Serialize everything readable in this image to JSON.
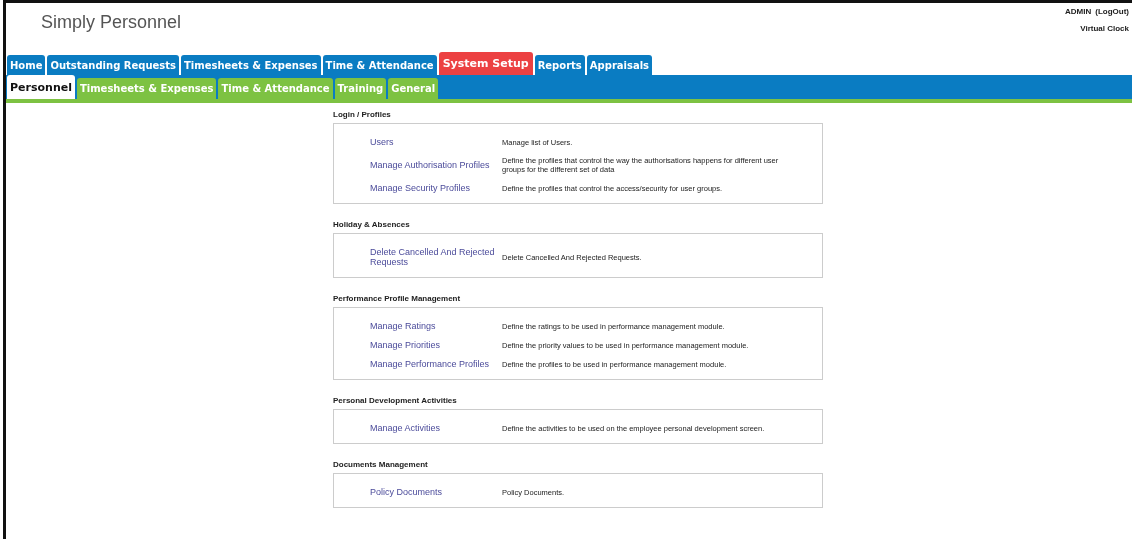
{
  "header": {
    "app_title": "Simply Personnel",
    "user": "ADMIN",
    "logout": "(LogOut)",
    "clock_link": "Virtual Clock"
  },
  "main_tabs": [
    {
      "label": "Home",
      "selected": false
    },
    {
      "label": "Outstanding Requests",
      "selected": false
    },
    {
      "label": "Timesheets & Expenses",
      "selected": false
    },
    {
      "label": "Time & Attendance",
      "selected": false
    },
    {
      "label": "System Setup",
      "selected": true
    },
    {
      "label": "Reports",
      "selected": false
    },
    {
      "label": "Appraisals",
      "selected": false
    }
  ],
  "sub_tabs": [
    {
      "label": "Personnel",
      "selected": true
    },
    {
      "label": "Timesheets & Expenses",
      "selected": false
    },
    {
      "label": "Time & Attendance",
      "selected": false
    },
    {
      "label": "Training",
      "selected": false
    },
    {
      "label": "General",
      "selected": false
    }
  ],
  "sections": [
    {
      "title": "Login / Profiles",
      "items": [
        {
          "link": "Users",
          "description": "Manage list of Users."
        },
        {
          "link": "Manage Authorisation Profiles",
          "description": "Define the profiles that control the way the authorisations happens for different user groups for the different set of data"
        },
        {
          "link": "Manage Security Profiles",
          "description": "Define the profiles that control the access/security for user groups."
        }
      ]
    },
    {
      "title": "Holiday & Absences",
      "items": [
        {
          "link": "Delete Cancelled And Rejected Requests",
          "description": "Delete Cancelled And Rejected Requests."
        }
      ]
    },
    {
      "title": "Performance Profile Management",
      "items": [
        {
          "link": "Manage Ratings",
          "description": "Define the ratings to be used in performance management module."
        },
        {
          "link": "Manage Priorities",
          "description": "Define the priority values to be used in performance management module."
        },
        {
          "link": "Manage Performance Profiles",
          "description": "Define the profiles to be used in performance management module."
        }
      ]
    },
    {
      "title": "Personal Development Activities",
      "items": [
        {
          "link": "Manage Activities",
          "description": "Define the activities to be used on the employee personal development screen."
        }
      ]
    },
    {
      "title": "Documents Management",
      "items": [
        {
          "link": "Policy Documents",
          "description": "Policy Documents."
        }
      ]
    }
  ]
}
